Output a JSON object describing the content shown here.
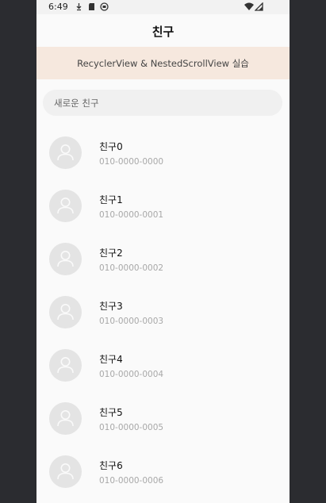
{
  "status_bar": {
    "time": "6:49",
    "icons_left": [
      "download-icon",
      "sd-card-icon",
      "app-circle-icon"
    ],
    "icons_right": [
      "wifi-icon",
      "signal-icon"
    ]
  },
  "app_bar": {
    "title": "친구"
  },
  "banner": {
    "text": "RecyclerView & NestedScrollView 실습",
    "color": "#f6e8de"
  },
  "search": {
    "placeholder": "새로운 친구"
  },
  "friends": [
    {
      "name": "친구0",
      "phone": "010-0000-0000"
    },
    {
      "name": "친구1",
      "phone": "010-0000-0001"
    },
    {
      "name": "친구2",
      "phone": "010-0000-0002"
    },
    {
      "name": "친구3",
      "phone": "010-0000-0003"
    },
    {
      "name": "친구4",
      "phone": "010-0000-0004"
    },
    {
      "name": "친구5",
      "phone": "010-0000-0005"
    },
    {
      "name": "친구6",
      "phone": "010-0000-0006"
    }
  ]
}
